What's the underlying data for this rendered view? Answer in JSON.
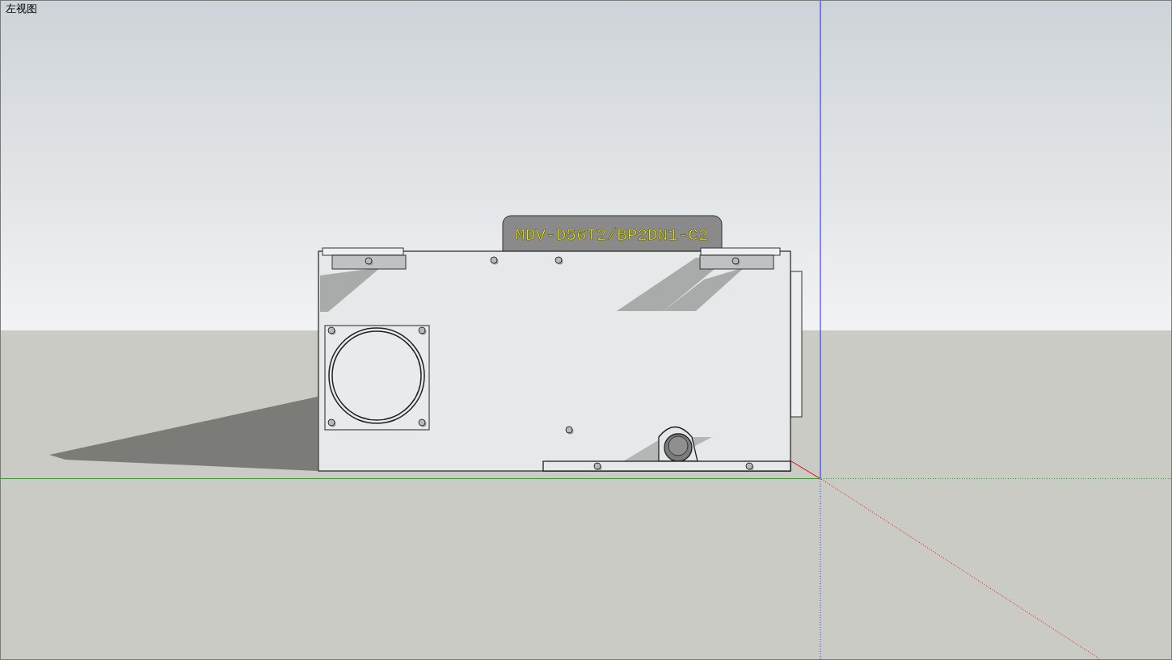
{
  "viewport": {
    "view_name": "左视图"
  },
  "model": {
    "label": "MDV-D56T2/BP2DN1-C2"
  }
}
